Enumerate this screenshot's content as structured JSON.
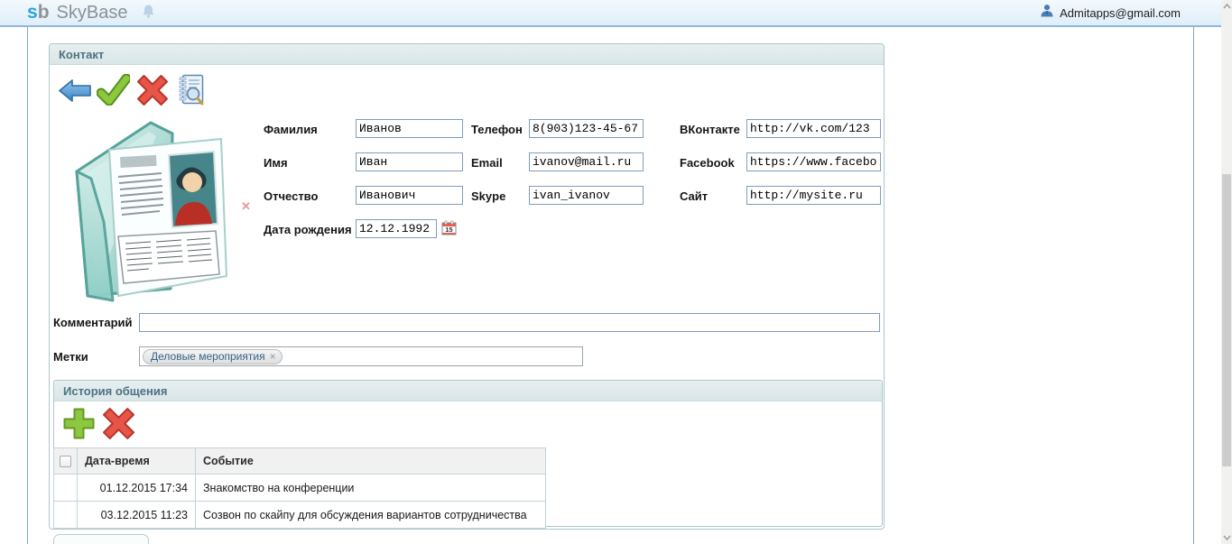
{
  "topbar": {
    "logo_s": "s",
    "logo_b": "b",
    "logo_name": "SkyBase",
    "user_email": "Admitapps@gmail.com",
    "icons": {
      "bell": "notifications-bell",
      "user": "user-person"
    }
  },
  "contact": {
    "title": "Контакт",
    "toolbar_icons": {
      "back": "back-arrow",
      "save": "green-check",
      "delete": "red-cross",
      "journal": "journal-search"
    },
    "photo_icons": {
      "photo": "contact-card-photo",
      "remove": "✕"
    },
    "fields": {
      "surname": {
        "label": "Фамилия",
        "value": "Иванов"
      },
      "firstname": {
        "label": "Имя",
        "value": "Иван"
      },
      "patronymic": {
        "label": "Отчество",
        "value": "Иванович"
      },
      "birthdate": {
        "label": "Дата рождения",
        "value": "12.12.1992"
      },
      "phone": {
        "label": "Телефон",
        "value": "8(903)123-45-67"
      },
      "email": {
        "label": "Email",
        "value": "ivanov@mail.ru"
      },
      "skype": {
        "label": "Skype",
        "value": "ivan_ivanov"
      },
      "vk": {
        "label": "ВКонтакте",
        "value": "http://vk.com/123"
      },
      "facebook": {
        "label": "Facebook",
        "value": "https://www.facebook"
      },
      "site": {
        "label": "Сайт",
        "value": "http://mysite.ru"
      }
    },
    "calendar_icon_day": "15",
    "comment": {
      "label": "Комментарий",
      "value": ""
    },
    "tags": {
      "label": "Метки",
      "items": [
        {
          "label": "Деловые мероприятия",
          "remove": "×"
        }
      ]
    }
  },
  "history": {
    "title": "История общения",
    "toolbar_icons": {
      "add": "green-plus",
      "delete": "red-cross"
    },
    "table": {
      "columns": {
        "datetime": "Дата-время",
        "event": "Событие"
      },
      "rows": [
        {
          "datetime": "01.12.2015 17:34",
          "event": "Знакомство на конференции"
        },
        {
          "datetime": "03.12.2015 11:23",
          "event": "Созвон по скайпу для обсуждения вариантов сотрудничества"
        }
      ]
    }
  },
  "colors": {
    "accent_blue": "#2aa4e2",
    "topbar_border": "#8fb6dd",
    "panel_border": "#adc6cd",
    "panel_header_bg": "#dde9ea",
    "panel_header_text": "#4e7280",
    "input_border": "#7f9db9",
    "tag_text": "#36648b",
    "check_green": "#8dc63f",
    "cross_red": "#e65548",
    "arrow_blue": "#5598d6"
  }
}
